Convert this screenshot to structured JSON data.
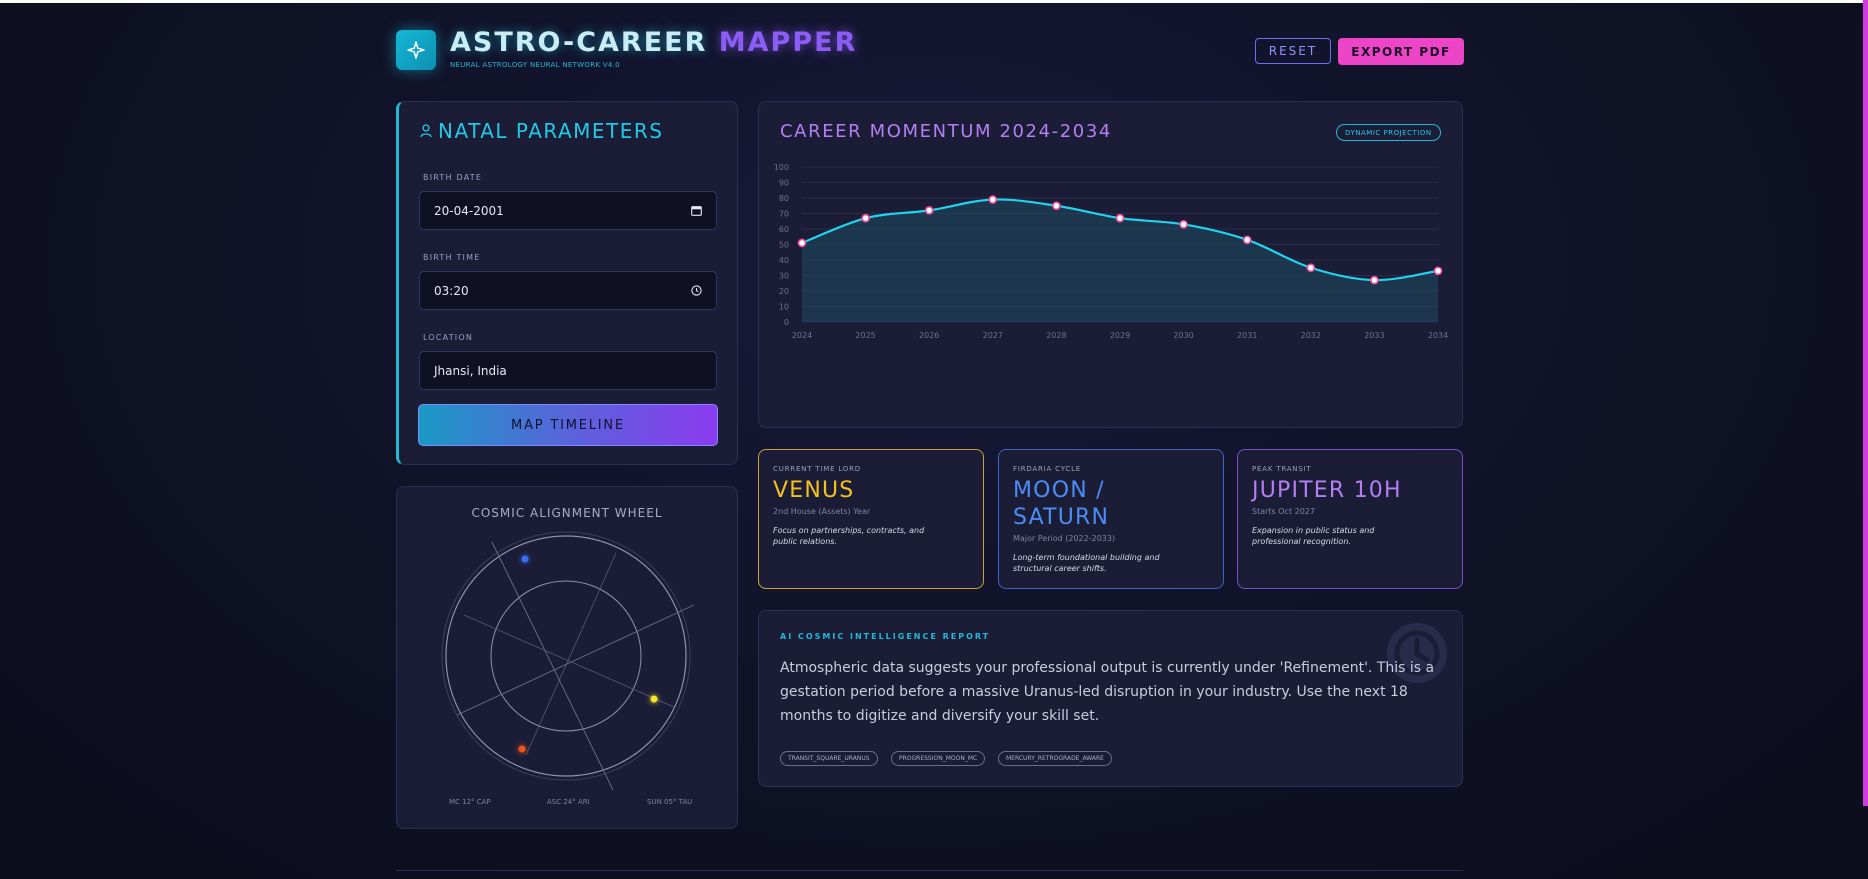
{
  "header": {
    "title_main": "ASTRO-CAREER",
    "title_accent": "MAPPER",
    "subtitle": "NEURAL ASTROLOGY NEURAL NETWORK V4.0",
    "reset_label": "RESET",
    "export_label": "EXPORT PDF"
  },
  "natal": {
    "title": "NATAL PARAMETERS",
    "birth_date_label": "BIRTH DATE",
    "birth_date_value": "20-04-2001",
    "birth_time_label": "BIRTH TIME",
    "birth_time_value": "03:20",
    "location_label": "LOCATION",
    "location_value": "Jhansi, India",
    "submit_label": "MAP TIMELINE"
  },
  "wheel": {
    "title": "COSMIC ALIGNMENT WHEEL",
    "foot_mc": "MC 12° CAP",
    "foot_asc": "ASC 24° ARI",
    "foot_sun": "SUN 05° TAU",
    "planet_colors": [
      "#3b6cf6",
      "#f5e52b",
      "#f0541e"
    ]
  },
  "chart": {
    "title": "CAREER MOMENTUM 2024-2034",
    "badge": "DYNAMIC PROJECTION"
  },
  "chart_data": {
    "type": "area",
    "title": "CAREER MOMENTUM 2024-2034",
    "x": [
      "2024",
      "2025",
      "2026",
      "2027",
      "2028",
      "2029",
      "2030",
      "2031",
      "2032",
      "2033",
      "2034"
    ],
    "series": [
      {
        "values": [
          51,
          67,
          72,
          79,
          75,
          67,
          63,
          53,
          35,
          27,
          33
        ]
      }
    ],
    "yticks": [
      0,
      10,
      20,
      30,
      40,
      50,
      60,
      70,
      80,
      90,
      100
    ],
    "ylim": [
      0,
      100
    ],
    "grid": true,
    "colors": {
      "line": "#22d3ee",
      "fill": "#1d4a63",
      "point_fill": "#ffffff",
      "point_stroke": "#ec4899"
    }
  },
  "insights": [
    {
      "label": "CURRENT TIME LORD",
      "value": "VENUS",
      "sub": "2nd House (Assets) Year",
      "desc": "Focus on partnerships, contracts, and public relations.",
      "color": "#f5c21b",
      "border": "#c9a13a"
    },
    {
      "label": "FIRDARIA CYCLE",
      "value_line1": "MOON /",
      "value_line2": "SATURN",
      "sub": "Major Period (2022-2033)",
      "desc": "Long-term foundational building and structural career shifts.",
      "color": "#4c8cf6",
      "border": "#3d63c9"
    },
    {
      "label": "PEAK TRANSIT",
      "value": "JUPITER 10H",
      "sub": "Starts Oct 2027",
      "desc": "Expansion in public status and professional recognition.",
      "color": "#b47ff3",
      "border": "#7a4fc9"
    }
  ],
  "report": {
    "label": "AI COSMIC INTELLIGENCE REPORT",
    "text": "Atmospheric data suggests your professional output is currently under 'Refinement'. This is a gestation period before a massive Uranus-led disruption in your industry. Use the next 18 months to digitize and diversify your skill set.",
    "tags": [
      "TRANSIT_SQUARE_URANUS",
      "PROGRESSION_MOON_MC",
      "MERCURY_RETROGRADE_AWARE"
    ]
  }
}
